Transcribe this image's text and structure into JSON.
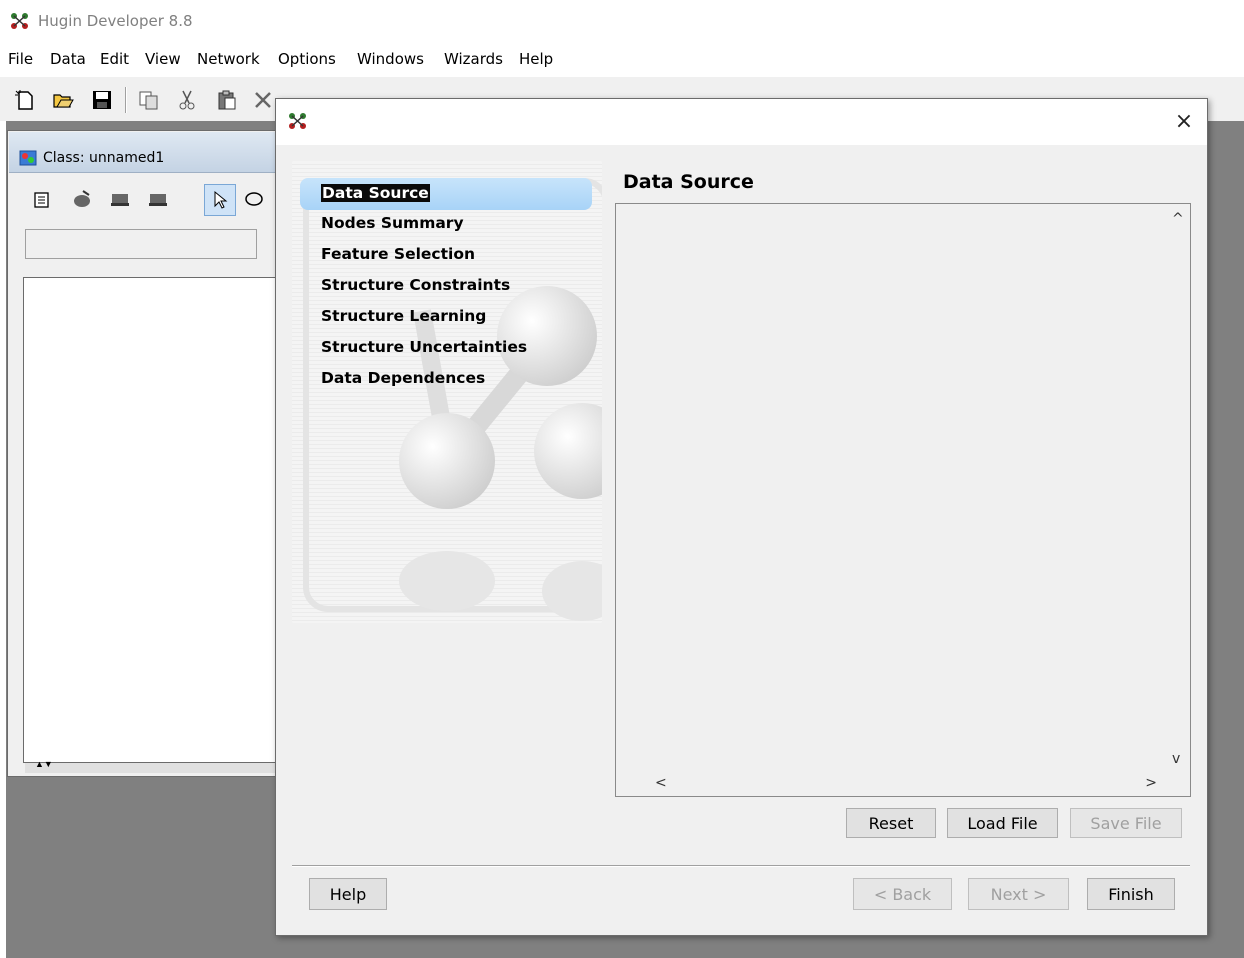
{
  "app": {
    "title": "Hugin Developer 8.8"
  },
  "menu": [
    "File",
    "Data",
    "Edit",
    "View",
    "Network",
    "Options",
    "Windows",
    "Wizards",
    "Help"
  ],
  "toolbar_icons": [
    "new-icon",
    "open-icon",
    "save-icon",
    "copy-icon",
    "cut-icon",
    "paste-icon",
    "delete-icon",
    "window-icon",
    "window-icon",
    "window-icon",
    "help-icon"
  ],
  "class_window": {
    "title": "Class: unnamed1",
    "tool_icons": [
      "properties-icon",
      "compile-icon",
      "node-icon",
      "node-icon",
      "select-pointer-icon",
      "ellipse-icon"
    ]
  },
  "wizard": {
    "steps": [
      "Data Source",
      "Nodes Summary",
      "Feature Selection",
      "Structure Constraints",
      "Structure Learning",
      "Structure Uncertainties",
      "Data Dependences"
    ],
    "active_step": "Data Source",
    "section_title": "Data Source",
    "buttons": {
      "reset": "Reset",
      "load_file": "Load File",
      "save_file": "Save File",
      "help": "Help",
      "back": "< Back",
      "next": "Next >",
      "finish": "Finish"
    },
    "close": "×",
    "scroll": {
      "up": "^",
      "down": "v",
      "left": "<",
      "right": ">"
    }
  },
  "colors": {
    "desktop": "#808080",
    "active_step_bg": "#a8d3f7"
  }
}
